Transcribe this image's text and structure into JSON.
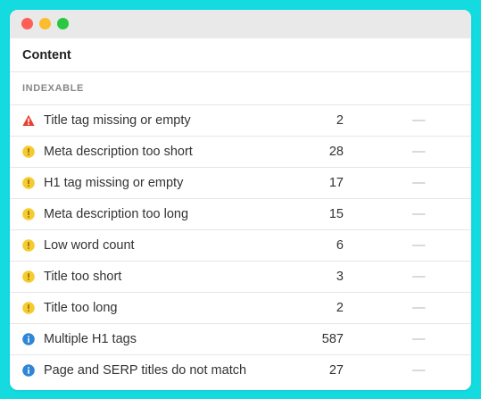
{
  "panel": {
    "title": "Content",
    "section": "INDEXABLE"
  },
  "colors": {
    "error": "#e8412f",
    "warning": "#f6cb2f",
    "notice": "#2f86d4"
  },
  "issues": [
    {
      "label": "Title tag missing or empty",
      "count": "2",
      "change": "—",
      "severity": "error",
      "icon": "error-triangle-icon"
    },
    {
      "label": "Meta description too short",
      "count": "28",
      "change": "—",
      "severity": "warning",
      "icon": "warning-circle-icon"
    },
    {
      "label": "H1 tag missing or empty",
      "count": "17",
      "change": "—",
      "severity": "warning",
      "icon": "warning-circle-icon"
    },
    {
      "label": "Meta description too long",
      "count": "15",
      "change": "—",
      "severity": "warning",
      "icon": "warning-circle-icon"
    },
    {
      "label": "Low word count",
      "count": "6",
      "change": "—",
      "severity": "warning",
      "icon": "warning-circle-icon"
    },
    {
      "label": "Title too short",
      "count": "3",
      "change": "—",
      "severity": "warning",
      "icon": "warning-circle-icon"
    },
    {
      "label": "Title too long",
      "count": "2",
      "change": "—",
      "severity": "warning",
      "icon": "warning-circle-icon"
    },
    {
      "label": "Multiple H1 tags",
      "count": "587",
      "change": "—",
      "severity": "notice",
      "icon": "info-circle-icon"
    },
    {
      "label": "Page and SERP titles do not match",
      "count": "27",
      "change": "—",
      "severity": "notice",
      "icon": "info-circle-icon"
    }
  ]
}
